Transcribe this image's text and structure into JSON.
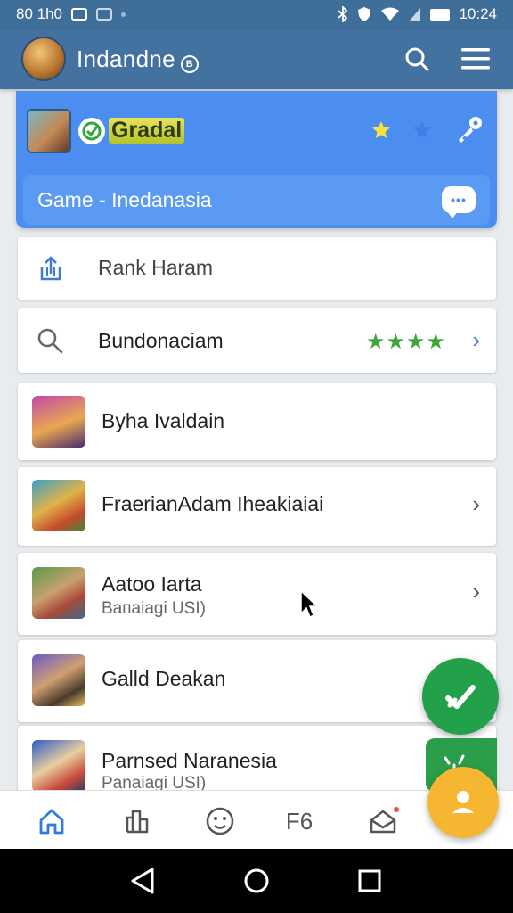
{
  "status_bar": {
    "left_text": "80 1h0",
    "time": "10:24"
  },
  "app_bar": {
    "title": "Indandne",
    "badge": "B"
  },
  "header_card": {
    "logo_text": "Gradal",
    "search_text": "Game - Inedanasia"
  },
  "rows": [
    {
      "title": "Rank Haram",
      "icon": "share-icon"
    },
    {
      "title": "Bundonaciam",
      "icon": "search-icon",
      "stars": "★★★★"
    },
    {
      "title": "Byha Ivaldain",
      "icon": "game-thumbnail"
    },
    {
      "title": "FraerianAdam Ihеakiaiai",
      "icon": "game-thumbnail"
    },
    {
      "title": "Aatoo Iarta",
      "subtitle": "Bапaiagi USI)",
      "icon": "game-thumbnail"
    },
    {
      "title": "Galld Deakan",
      "icon": "game-thumbnail"
    },
    {
      "title": "Parnsed Naranesia",
      "subtitle": "Panaiagi USI)",
      "icon": "game-thumbnail"
    }
  ],
  "bottom_nav": {
    "f6_label": "F6"
  },
  "colors": {
    "app_bar": "#4472a0",
    "accent_blue": "#4b8ef0",
    "fab_green": "#22a04a",
    "fab_yellow": "#f5b731",
    "star_green": "#3ea63a"
  }
}
